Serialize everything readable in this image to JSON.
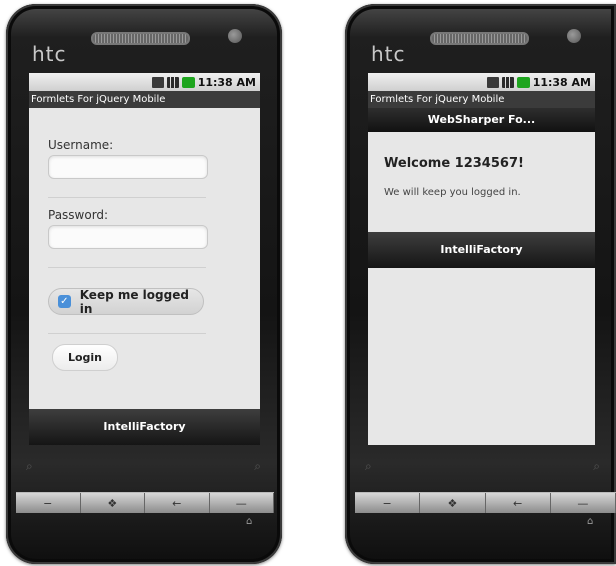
{
  "left_phone": {
    "brand": "htc",
    "status_time": "11:38 AM",
    "app_title": "Formlets For jQuery Mobile",
    "username_label": "Username:",
    "password_label": "Password:",
    "keep_logged_label": "Keep me logged in",
    "login_label": "Login",
    "footer": "IntelliFactory"
  },
  "right_phone": {
    "brand": "htc",
    "status_time": "11:38 AM",
    "app_title": "Formlets For jQuery Mobile",
    "header": "WebSharper Fo...",
    "welcome_title": "Welcome 1234567!",
    "welcome_text": "We will keep you logged in.",
    "footer": "IntelliFactory"
  },
  "icons": {
    "search": "⌕",
    "back": "←",
    "home": "⌂",
    "windows": "❖",
    "call": "−",
    "end": "—"
  }
}
